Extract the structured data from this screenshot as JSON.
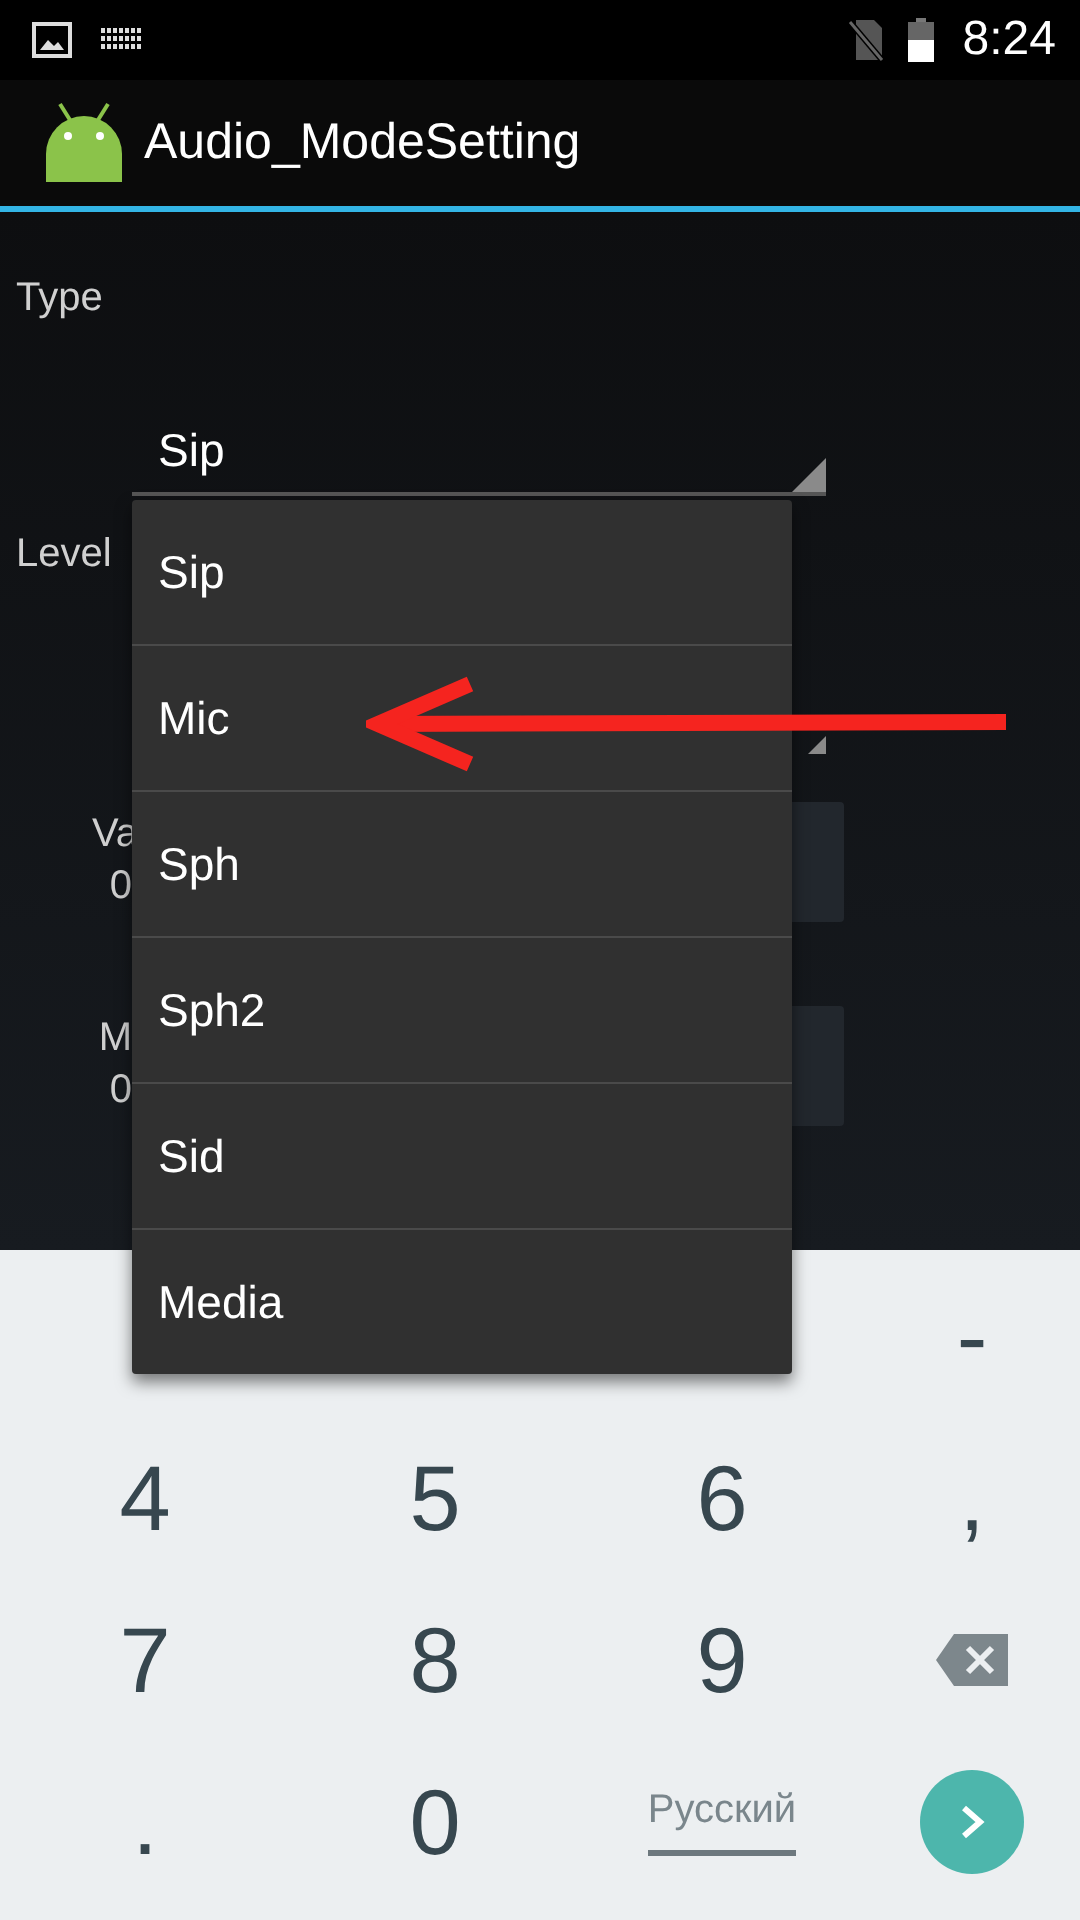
{
  "status_bar": {
    "time": "8:24"
  },
  "app_bar": {
    "title": "Audio_ModeSetting"
  },
  "form": {
    "type_label": "Type",
    "type_value": "Sip",
    "level_label": "Level",
    "rows": [
      {
        "label": "Va",
        "value": "0"
      },
      {
        "label": "M",
        "value": "0"
      }
    ]
  },
  "dropdown": {
    "items": [
      "Sip",
      "Mic",
      "Sph",
      "Sph2",
      "Sid",
      "Media"
    ]
  },
  "keyboard": {
    "rows": [
      [
        "",
        "",
        "",
        {
          "kind": "char",
          "label": "-"
        }
      ],
      [
        {
          "kind": "char",
          "label": "4"
        },
        {
          "kind": "char",
          "label": "5"
        },
        {
          "kind": "char",
          "label": "6"
        },
        {
          "kind": "char",
          "label": ","
        }
      ],
      [
        {
          "kind": "char",
          "label": "7"
        },
        {
          "kind": "char",
          "label": "8"
        },
        {
          "kind": "char",
          "label": "9"
        },
        {
          "kind": "backspace"
        }
      ],
      [
        {
          "kind": "char",
          "label": "."
        },
        {
          "kind": "char",
          "label": "0"
        },
        {
          "kind": "space",
          "label": "Русский"
        },
        {
          "kind": "enter"
        }
      ]
    ]
  }
}
